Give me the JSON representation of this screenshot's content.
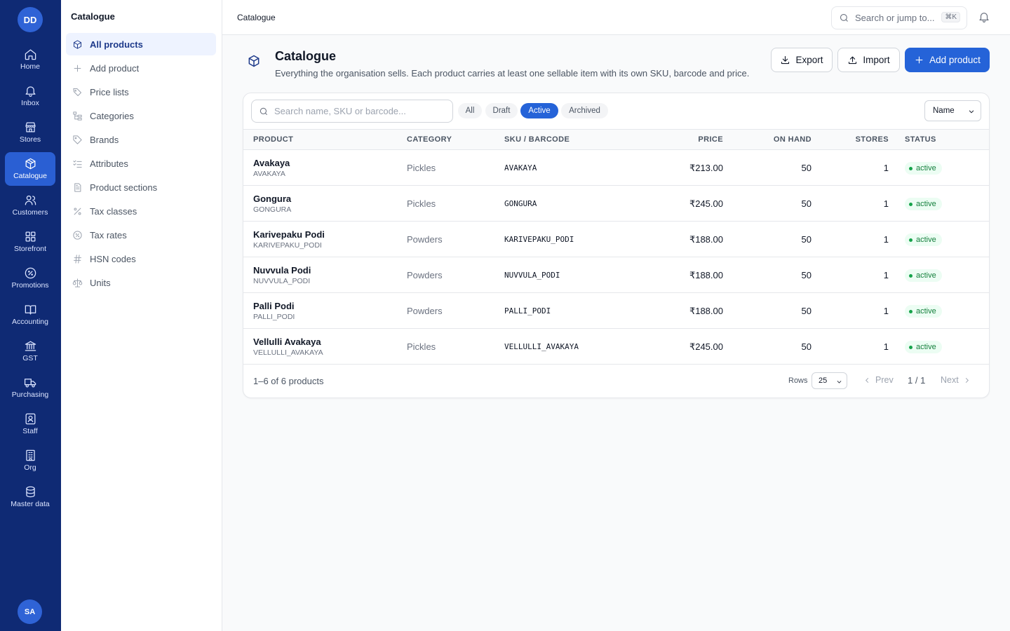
{
  "rail": {
    "logo": "DD",
    "items": [
      {
        "label": "Home",
        "icon": "home-icon"
      },
      {
        "label": "Inbox",
        "icon": "bell-icon"
      },
      {
        "label": "Stores",
        "icon": "store-icon"
      },
      {
        "label": "Catalogue",
        "icon": "box-icon",
        "active": true
      },
      {
        "label": "Customers",
        "icon": "users-icon"
      },
      {
        "label": "Storefront",
        "icon": "grid-icon"
      },
      {
        "label": "Promotions",
        "icon": "percent-badge-icon"
      },
      {
        "label": "Accounting",
        "icon": "book-icon"
      },
      {
        "label": "GST",
        "icon": "bank-icon"
      },
      {
        "label": "Purchasing",
        "icon": "truck-icon"
      },
      {
        "label": "Staff",
        "icon": "id-badge-icon"
      },
      {
        "label": "Org",
        "icon": "building-icon"
      },
      {
        "label": "Master data",
        "icon": "database-icon"
      }
    ],
    "avatar": "SA"
  },
  "sidebar": {
    "title": "Catalogue",
    "items": [
      {
        "label": "All products",
        "icon": "box-icon",
        "active": true
      },
      {
        "label": "Add product",
        "icon": "plus-icon"
      },
      {
        "label": "Price lists",
        "icon": "tags-icon"
      },
      {
        "label": "Categories",
        "icon": "tree-icon"
      },
      {
        "label": "Brands",
        "icon": "tag-icon"
      },
      {
        "label": "Attributes",
        "icon": "checklist-icon"
      },
      {
        "label": "Product sections",
        "icon": "document-icon"
      },
      {
        "label": "Tax classes",
        "icon": "percent-icon"
      },
      {
        "label": "Tax rates",
        "icon": "percent-badge-icon"
      },
      {
        "label": "HSN codes",
        "icon": "hash-icon"
      },
      {
        "label": "Units",
        "icon": "scale-icon"
      }
    ]
  },
  "topbar": {
    "breadcrumb": "Catalogue",
    "search_placeholder": "Search or jump to...",
    "shortcut": "⌘K"
  },
  "header": {
    "title": "Catalogue",
    "subtitle": "Everything the organisation sells. Each product carries at least one sellable item with its own SKU, barcode and price.",
    "export_label": "Export",
    "import_label": "Import",
    "add_label": "Add product"
  },
  "filters": {
    "search_placeholder": "Search name, SKU or barcode...",
    "chips": [
      "All",
      "Draft",
      "Active",
      "Archived"
    ],
    "active_chip": "Active",
    "sort_value": "Name"
  },
  "table": {
    "columns": [
      "PRODUCT",
      "CATEGORY",
      "SKU / BARCODE",
      "PRICE",
      "ON HAND",
      "STORES",
      "STATUS"
    ],
    "rows": [
      {
        "name": "Avakaya",
        "code": "AVAKAYA",
        "category": "Pickles",
        "sku": "AVAKAYA",
        "price": "₹213.00",
        "on_hand": "50",
        "stores": "1",
        "status": "active"
      },
      {
        "name": "Gongura",
        "code": "GONGURA",
        "category": "Pickles",
        "sku": "GONGURA",
        "price": "₹245.00",
        "on_hand": "50",
        "stores": "1",
        "status": "active"
      },
      {
        "name": "Karivepaku Podi",
        "code": "KARIVEPAKU_PODI",
        "category": "Powders",
        "sku": "KARIVEPAKU_PODI",
        "price": "₹188.00",
        "on_hand": "50",
        "stores": "1",
        "status": "active"
      },
      {
        "name": "Nuvvula Podi",
        "code": "NUVVULA_PODI",
        "category": "Powders",
        "sku": "NUVVULA_PODI",
        "price": "₹188.00",
        "on_hand": "50",
        "stores": "1",
        "status": "active"
      },
      {
        "name": "Palli Podi",
        "code": "PALLI_PODI",
        "category": "Powders",
        "sku": "PALLI_PODI",
        "price": "₹188.00",
        "on_hand": "50",
        "stores": "1",
        "status": "active"
      },
      {
        "name": "Vellulli Avakaya",
        "code": "VELLULLI_AVAKAYA",
        "category": "Pickles",
        "sku": "VELLULLI_AVAKAYA",
        "price": "₹245.00",
        "on_hand": "50",
        "stores": "1",
        "status": "active"
      }
    ]
  },
  "footer": {
    "count": "1–6 of 6 products",
    "rows_label": "Rows",
    "rows_value": "25",
    "prev": "Prev",
    "page": "1 / 1",
    "next": "Next"
  },
  "colors": {
    "rail_bg": "#0f2a74",
    "accent": "#2563d8",
    "status_active": "#15803d"
  }
}
